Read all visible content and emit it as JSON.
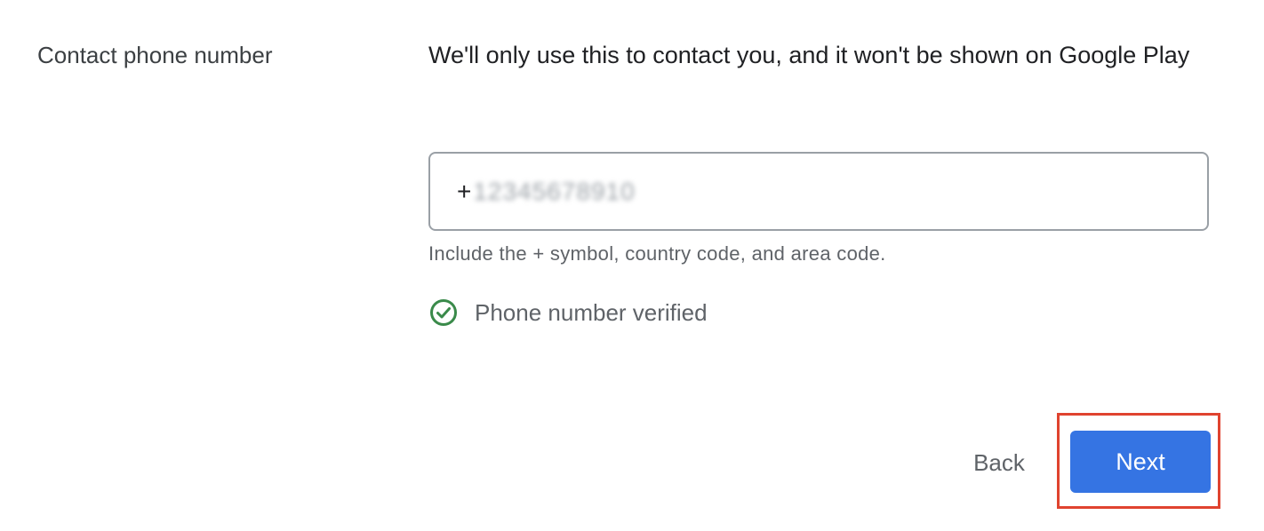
{
  "section": {
    "label": "Contact phone number",
    "description": "We'll only use this to contact you, and it won't be shown on Google Play"
  },
  "phone": {
    "prefix": "+",
    "value": "12345678910",
    "helper": "Include the + symbol, country code, and area code."
  },
  "verification": {
    "status_text": "Phone number verified",
    "icon": "check-circle-icon",
    "color": "#3a8a4a"
  },
  "actions": {
    "back_label": "Back",
    "next_label": "Next",
    "next_color": "#3574e3",
    "highlight_color": "#e0432f"
  }
}
